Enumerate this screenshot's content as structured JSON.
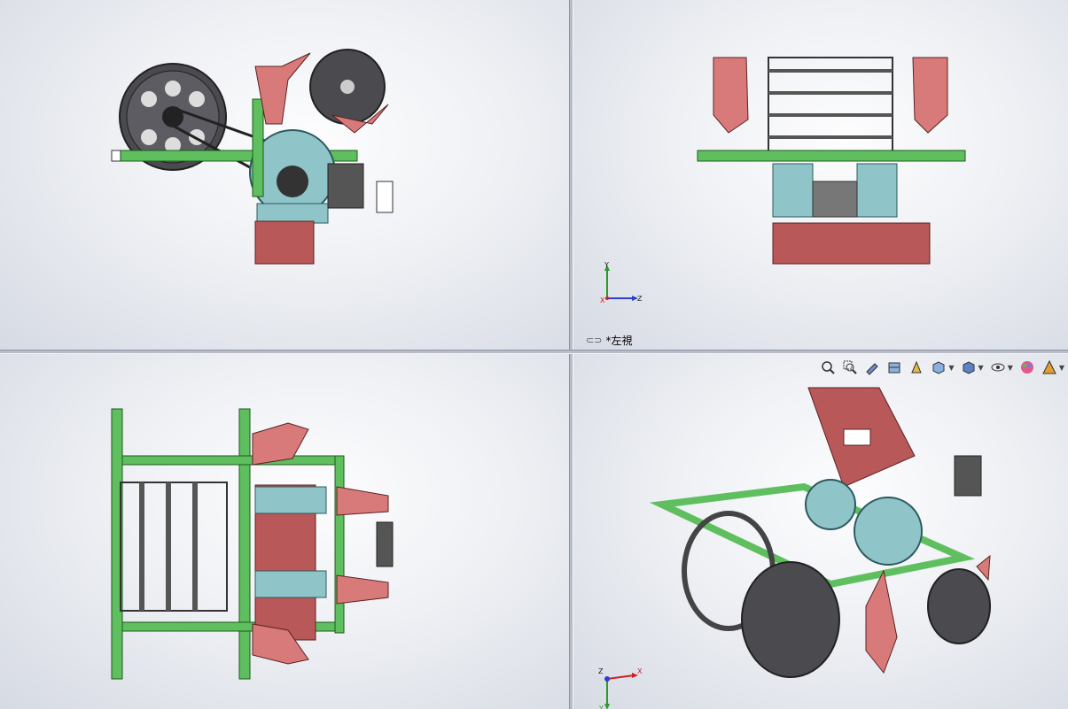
{
  "viewports": {
    "top_left": {
      "label": ""
    },
    "top_right": {
      "label": "*左視",
      "triad_axes": [
        "Y",
        "Z",
        "X"
      ]
    },
    "bottom_left": {
      "label": ""
    },
    "bottom_right": {
      "label": "",
      "triad_axes": [
        "Z",
        "X",
        "Y"
      ]
    }
  },
  "view_toolbar": {
    "buttons": [
      {
        "icon": "zoom-to-fit-icon"
      },
      {
        "icon": "zoom-to-area-icon"
      },
      {
        "icon": "previous-view-icon"
      },
      {
        "icon": "section-view-icon"
      },
      {
        "icon": "dynamic-annotation-views-icon"
      },
      {
        "icon": "view-orientation-icon"
      },
      {
        "icon": "display-style-icon"
      },
      {
        "icon": "hide-show-items-icon"
      },
      {
        "icon": "edit-appearance-icon"
      },
      {
        "icon": "apply-scene-icon"
      }
    ]
  },
  "colors": {
    "frame_green": "#5fbf5f",
    "hopper_red": "#b85858",
    "plow_red": "#d97a7a",
    "motor_teal": "#8fc4c8",
    "wheel_gray": "#4a4a4f"
  }
}
